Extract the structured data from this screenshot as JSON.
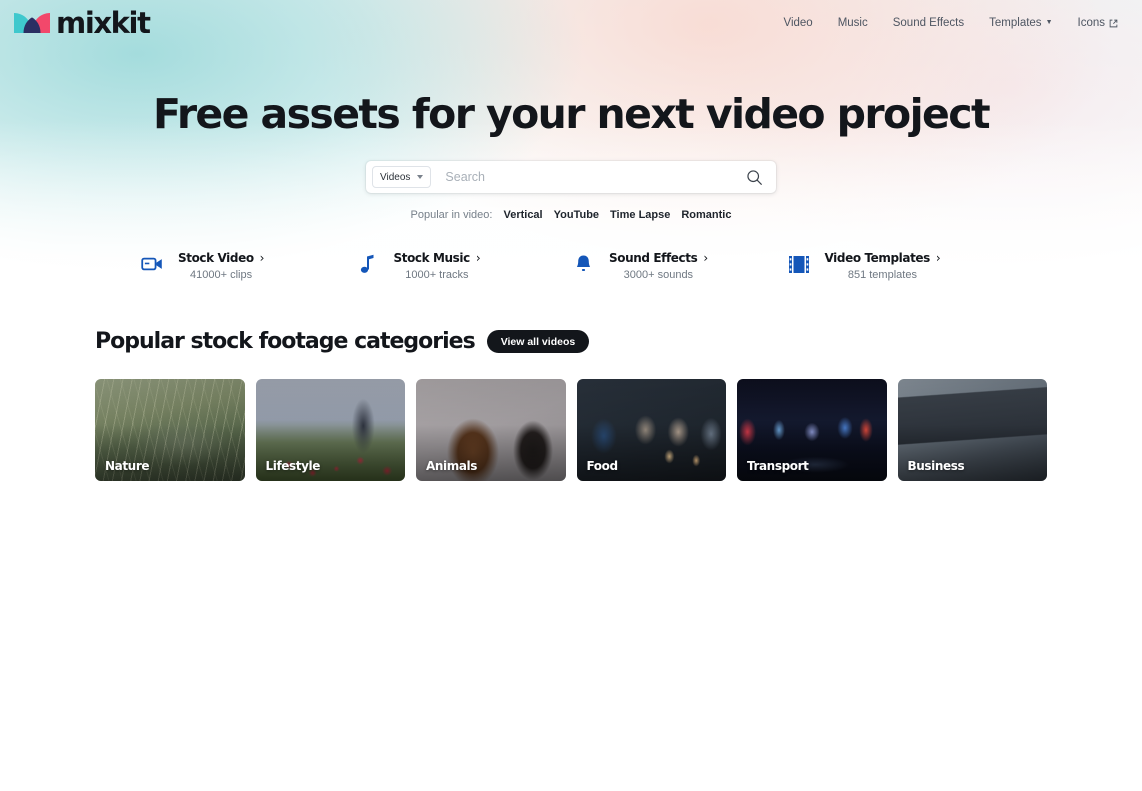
{
  "brand": {
    "name": "mixkit",
    "logo_colors": {
      "teal": "#3fc8cd",
      "pink": "#f2486b",
      "navy": "#2b2f63"
    }
  },
  "nav": {
    "items": [
      {
        "label": "Video",
        "icon": "",
        "has_caret": false
      },
      {
        "label": "Music",
        "icon": "",
        "has_caret": false
      },
      {
        "label": "Sound Effects",
        "icon": "",
        "has_caret": false
      },
      {
        "label": "Templates",
        "icon": "chevron-down-icon",
        "has_caret": true
      },
      {
        "label": "Icons",
        "icon": "external-link-icon",
        "has_caret": false
      }
    ]
  },
  "hero": {
    "title": "Free assets for your next video project"
  },
  "search": {
    "type_label": "Videos",
    "placeholder": "Search",
    "value": "",
    "icon": "search-icon"
  },
  "popular": {
    "label": "Popular in video:",
    "tags": [
      "Vertical",
      "YouTube",
      "Time Lapse",
      "Romantic"
    ]
  },
  "shortcuts": [
    {
      "title": "Stock Video",
      "chevron": "›",
      "subtitle": "41000+ clips",
      "icon": "video-camera-icon"
    },
    {
      "title": "Stock Music",
      "chevron": "›",
      "subtitle": "1000+ tracks",
      "icon": "music-note-icon"
    },
    {
      "title": "Sound Effects",
      "chevron": "›",
      "subtitle": "3000+ sounds",
      "icon": "bell-icon"
    },
    {
      "title": "Video Templates",
      "chevron": "›",
      "subtitle": "851 templates",
      "icon": "film-strip-icon"
    }
  ],
  "section": {
    "title": "Popular stock footage categories",
    "view_all_label": "View all videos"
  },
  "categories": [
    {
      "label": "Nature"
    },
    {
      "label": "Lifestyle"
    },
    {
      "label": "Animals"
    },
    {
      "label": "Food"
    },
    {
      "label": "Transport"
    },
    {
      "label": "Business"
    }
  ]
}
